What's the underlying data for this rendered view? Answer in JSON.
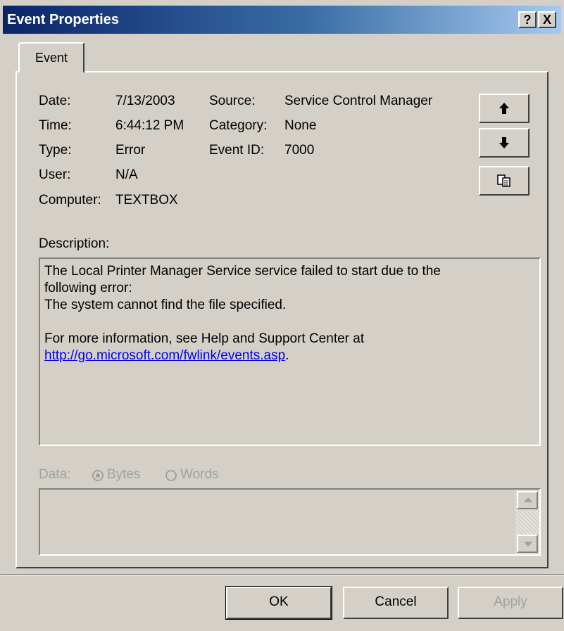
{
  "window": {
    "title": "Event Properties",
    "help_glyph": "?",
    "close_glyph": "X"
  },
  "tab": {
    "label": "Event"
  },
  "fields": {
    "date_label": "Date:",
    "date_value": "7/13/2003",
    "time_label": "Time:",
    "time_value": "6:44:12 PM",
    "type_label": "Type:",
    "type_value": "Error",
    "user_label": "User:",
    "user_value": "N/A",
    "computer_label": "Computer:",
    "computer_value": "TEXTBOX",
    "source_label": "Source:",
    "source_value": "Service Control Manager",
    "category_label": "Category:",
    "category_value": "None",
    "eventid_label": "Event ID:",
    "eventid_value": "7000"
  },
  "nav_icons": [
    "up-arrow-icon",
    "down-arrow-icon",
    "copy-icon"
  ],
  "description": {
    "label": "Description:",
    "line1": "The Local Printer Manager Service service failed to start due to the",
    "line2": "following error:",
    "line3": "The system cannot find the file specified.",
    "line4": "For more information, see Help and Support Center at",
    "link": "http://go.microsoft.com/fwlink/events.asp",
    "link_trailer": "."
  },
  "data": {
    "label": "Data:",
    "bytes_label": "Bytes",
    "words_label": "Words",
    "selected": "Bytes"
  },
  "buttons": {
    "ok": "OK",
    "cancel": "Cancel",
    "apply": "Apply"
  },
  "colors": {
    "title_bar": "#0a246a",
    "dialog_bg": "#d4d0c8",
    "link": "#0000ee"
  }
}
